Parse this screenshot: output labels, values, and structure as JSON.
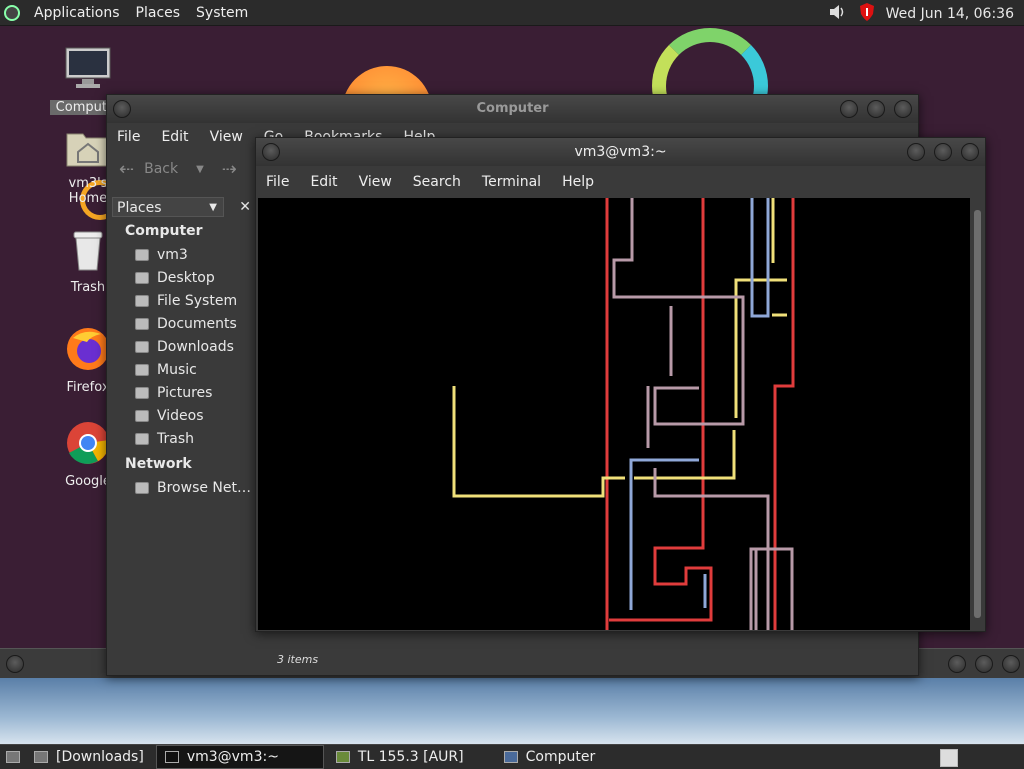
{
  "top_panel": {
    "menus": [
      "Applications",
      "Places",
      "System"
    ],
    "clock": "Wed Jun 14, 06:36",
    "tray_icons": [
      "speaker-icon",
      "shield-icon"
    ]
  },
  "desktop": {
    "icons": [
      {
        "label": "Computer",
        "icon": "computer-icon"
      },
      {
        "label": "vm3's Home",
        "icon": "home-folder-icon"
      },
      {
        "label": "Trash",
        "icon": "trash-icon"
      },
      {
        "label": "Firefox",
        "icon": "firefox-icon"
      },
      {
        "label": "Google",
        "icon": "chrome-icon"
      }
    ]
  },
  "file_manager": {
    "title": "Computer",
    "menus": [
      "File",
      "Edit",
      "View",
      "Go",
      "Bookmarks",
      "Help"
    ],
    "back_label": "Back",
    "places_label": "Places",
    "sections": [
      {
        "title": "Computer",
        "items": [
          "vm3",
          "Desktop",
          "File System",
          "Documents",
          "Downloads",
          "Music",
          "Pictures",
          "Videos",
          "Trash"
        ]
      },
      {
        "title": "Network",
        "items": [
          "Browse Net…"
        ]
      }
    ],
    "status": "3 items"
  },
  "terminal": {
    "title": "vm3@vm3:~",
    "menus": [
      "File",
      "Edit",
      "View",
      "Search",
      "Terminal",
      "Help"
    ],
    "colors": {
      "red": "#e03c3c",
      "yellow": "#f0e07a",
      "blue": "#8fa8d8",
      "mauve": "#b89aa8"
    }
  },
  "taskbar": {
    "items": [
      {
        "label": "[Downloads]",
        "icon": "folder-icon",
        "active": false
      },
      {
        "label": "vm3@vm3:~",
        "icon": "terminal-icon",
        "active": true
      },
      {
        "label": "TL 155.3 [AUR]",
        "icon": "game-cube-icon",
        "active": false
      },
      {
        "label": "Computer",
        "icon": "computer-icon",
        "active": false
      }
    ]
  }
}
